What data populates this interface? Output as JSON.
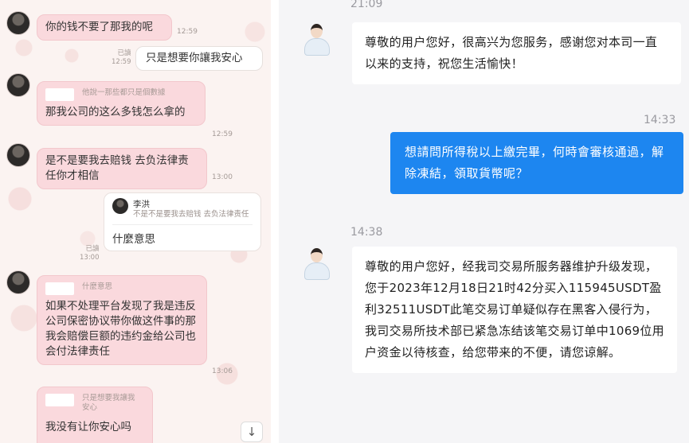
{
  "left_chat": {
    "messages": [
      {
        "text": "你的钱不要了那我的呢",
        "time": "12:59"
      },
      {
        "read": "已讀",
        "time": "12:59",
        "text": "只是想要你讓我安心"
      },
      {
        "quote": "他說一那些都只是個數據",
        "text": "那我公司的这么多钱怎么拿的",
        "time": "12:59"
      },
      {
        "text": "是不是要我去赔钱 去负法律责任你才相信",
        "time": "13:00"
      },
      {
        "reply_name": "李洪",
        "reply_snippet": "不是不是要我去赔钱 去负法律责任",
        "text": "什麼意思",
        "read": "已讀",
        "time": "13:00"
      },
      {
        "quote": "什麼意思",
        "text": "如果不处理平台发现了我是违反公司保密协议带你做这件事的那我会赔偿巨额的违约金给公司也会付法律责任",
        "time": "13:06"
      },
      {
        "quote": "只是想要我讓我安心",
        "text": "我没有让你安心吗"
      }
    ],
    "scroll_down_glyph": "↓"
  },
  "right_chat": {
    "top_time": "21:09",
    "agent_greeting": "尊敬的用户您好，很高兴为您服务，感谢您对本司一直以来的支持，祝您生活愉快！",
    "user_time": "14:33",
    "user_message": "想請問所得稅以上繳完畢，何時會審核通過，解除凍結，領取貨幣呢？",
    "agent_time": "14:38",
    "agent_reply": "尊敬的用户您好，经我司交易所服务器维护升级发现，您于2023年12月18日21时42分买入115945USDT盈利32511USDT此笔交易订单疑似存在黑客入侵行为，我司交易所技术部已紧急冻结该笔交易订单中1069位用户资金以待核查，给您带来的不便，请您谅解。"
  },
  "colors": {
    "user_bubble": "#1d86f0",
    "incoming_pink": "#fad9dd",
    "right_bg": "#f5f5f7"
  }
}
